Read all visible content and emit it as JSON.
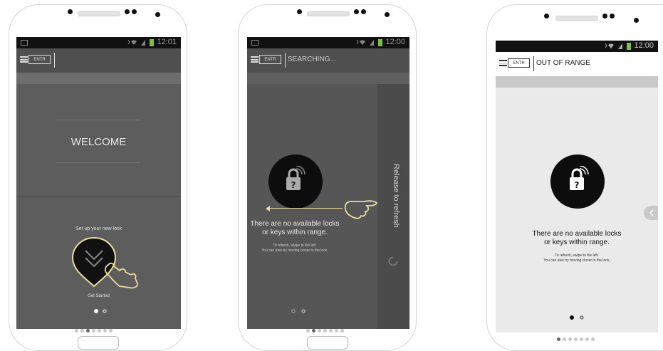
{
  "status": {
    "time1": "12:01",
    "time2": "12:00",
    "time3": "12:00"
  },
  "logo": {
    "text": "ENTR"
  },
  "phone1": {
    "welcome": "WELCOME",
    "setup": "Set up your new lock",
    "get_started": "Get Started"
  },
  "phone2": {
    "title": "SEARCHING...",
    "msg_line1": "There are no available locks",
    "msg_line2": "or keys within range.",
    "sub_line1": "To refresh, swipe to the left.",
    "sub_line2": "You can also try moving closer to the lock.",
    "release": "Release to refresh"
  },
  "phone3": {
    "title": "OUT OF RANGE",
    "msg_line1": "There are no available locks",
    "msg_line2": "or keys within range.",
    "sub_line1": "To refresh, swipe to the left.",
    "sub_line2": "You can also try moving closer to the lock."
  },
  "colors": {
    "accent": "#e8de9c",
    "battery": "#7fbf3f",
    "screen_dark": "#5d5d5d",
    "lock_bg": "#0d0d0d"
  },
  "icons": [
    "menu-icon",
    "lock-question-icon",
    "wifi-icon",
    "signal-icon",
    "battery-icon",
    "bluetooth-icon",
    "hand-pointer-icon",
    "refresh-icon",
    "swipe-arrow-icon",
    "chevron-left-icon"
  ]
}
